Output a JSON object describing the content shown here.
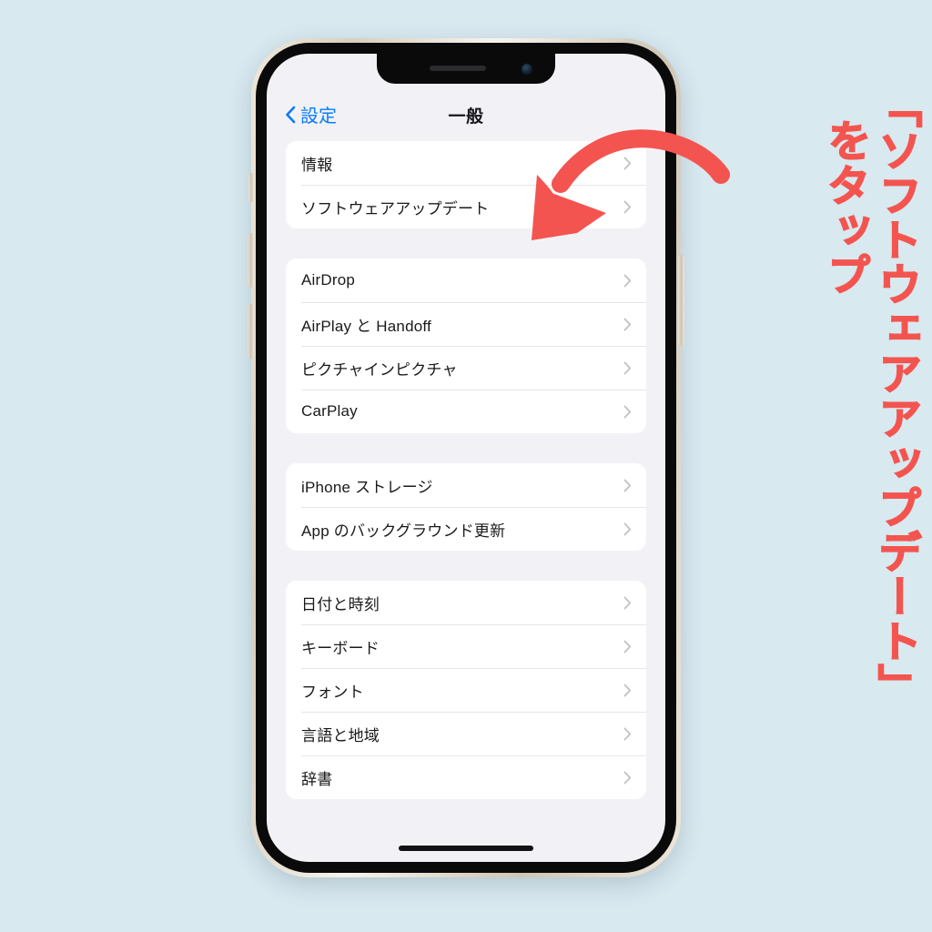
{
  "background_color": "#d8e9f0",
  "accent_color": "#f4544f",
  "link_color": "#0a7bfa",
  "annotation": {
    "arrow": "curved-down-left-arrow",
    "caption_main": "「ソフトウェアアップデート」",
    "caption_sub": "をタップ"
  },
  "device": {
    "name": "iphone",
    "notch_icons": [
      "speaker-grille",
      "front-camera"
    ],
    "side_buttons": [
      "mute-switch",
      "volume-up",
      "volume-down",
      "power"
    ],
    "home_indicator": true
  },
  "screen": {
    "navbar": {
      "back_label": "設定",
      "back_icon": "chevron-left-icon",
      "title": "一般"
    },
    "groups": [
      {
        "rows": [
          {
            "label": "情報",
            "chevron": "chevron-right-icon"
          },
          {
            "label": "ソフトウェアアップデート",
            "chevron": "chevron-right-icon"
          }
        ]
      },
      {
        "rows": [
          {
            "label": "AirDrop",
            "chevron": "chevron-right-icon"
          },
          {
            "label": "AirPlay と Handoff",
            "chevron": "chevron-right-icon"
          },
          {
            "label": "ピクチャインピクチャ",
            "chevron": "chevron-right-icon"
          },
          {
            "label": "CarPlay",
            "chevron": "chevron-right-icon"
          }
        ]
      },
      {
        "rows": [
          {
            "label": "iPhone ストレージ",
            "chevron": "chevron-right-icon"
          },
          {
            "label": "App のバックグラウンド更新",
            "chevron": "chevron-right-icon"
          }
        ]
      },
      {
        "rows": [
          {
            "label": "日付と時刻",
            "chevron": "chevron-right-icon"
          },
          {
            "label": "キーボード",
            "chevron": "chevron-right-icon"
          },
          {
            "label": "フォント",
            "chevron": "chevron-right-icon"
          },
          {
            "label": "言語と地域",
            "chevron": "chevron-right-icon"
          },
          {
            "label": "辞書",
            "chevron": "chevron-right-icon"
          }
        ]
      }
    ]
  }
}
